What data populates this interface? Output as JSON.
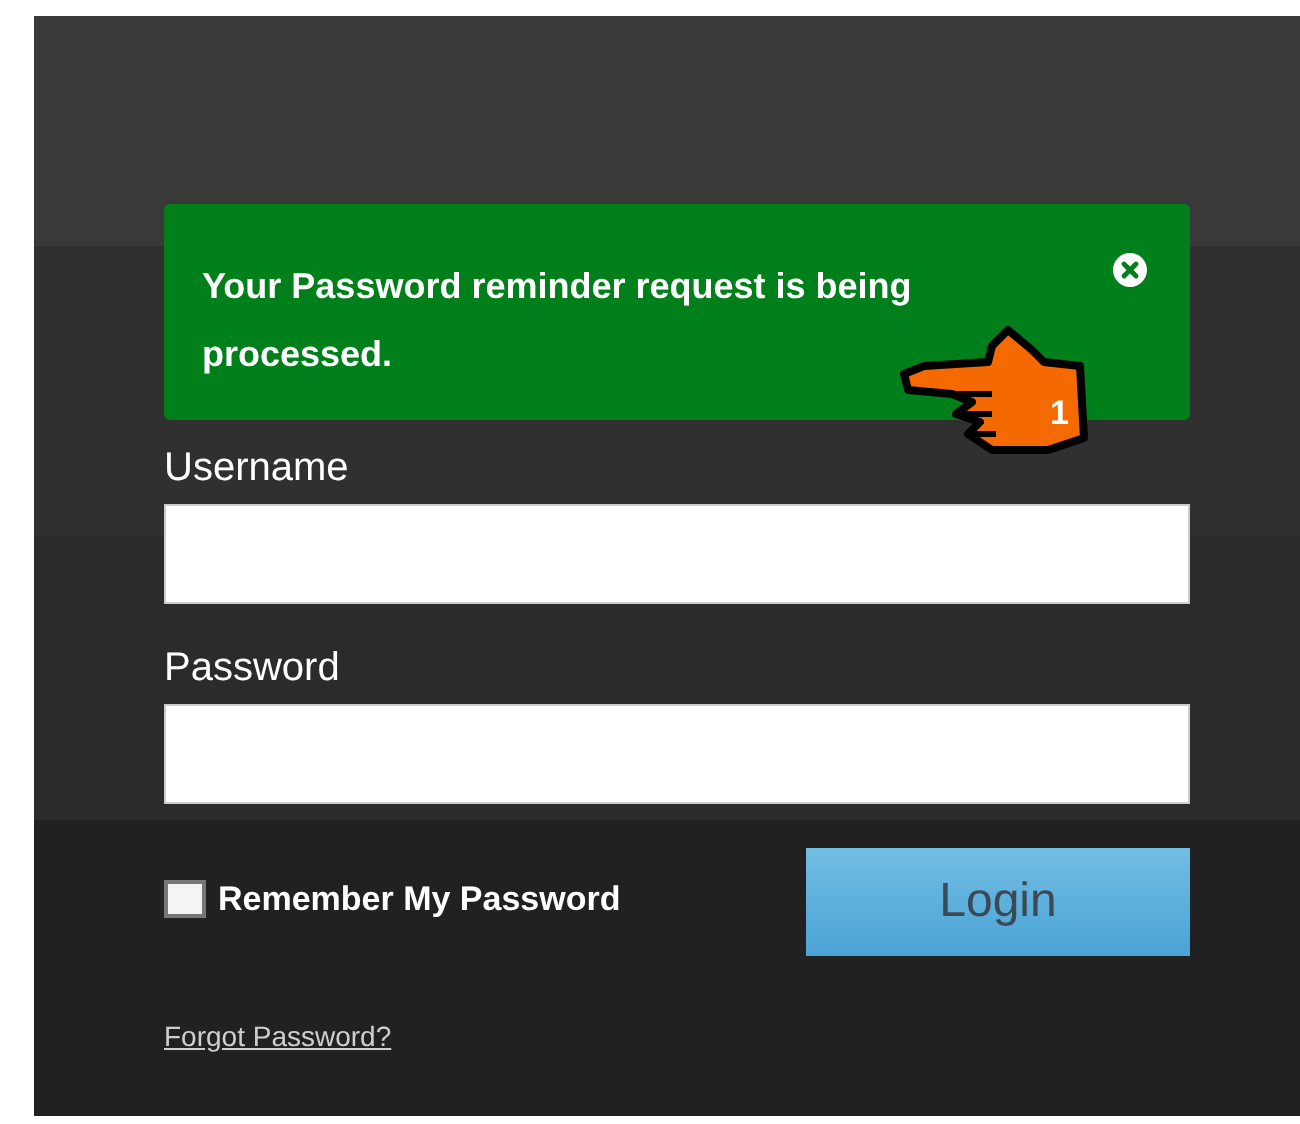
{
  "alert": {
    "message": "Your Password reminder request is being processed.",
    "dismissible": true
  },
  "callout": {
    "number": "1"
  },
  "fields": [
    {
      "label": "Username"
    },
    {
      "label": "Password"
    }
  ],
  "remember": {
    "label": "Remember My Password",
    "checked": false
  },
  "login_button": {
    "label": "Login"
  },
  "forgot_link": {
    "label": "Forgot Password?"
  }
}
